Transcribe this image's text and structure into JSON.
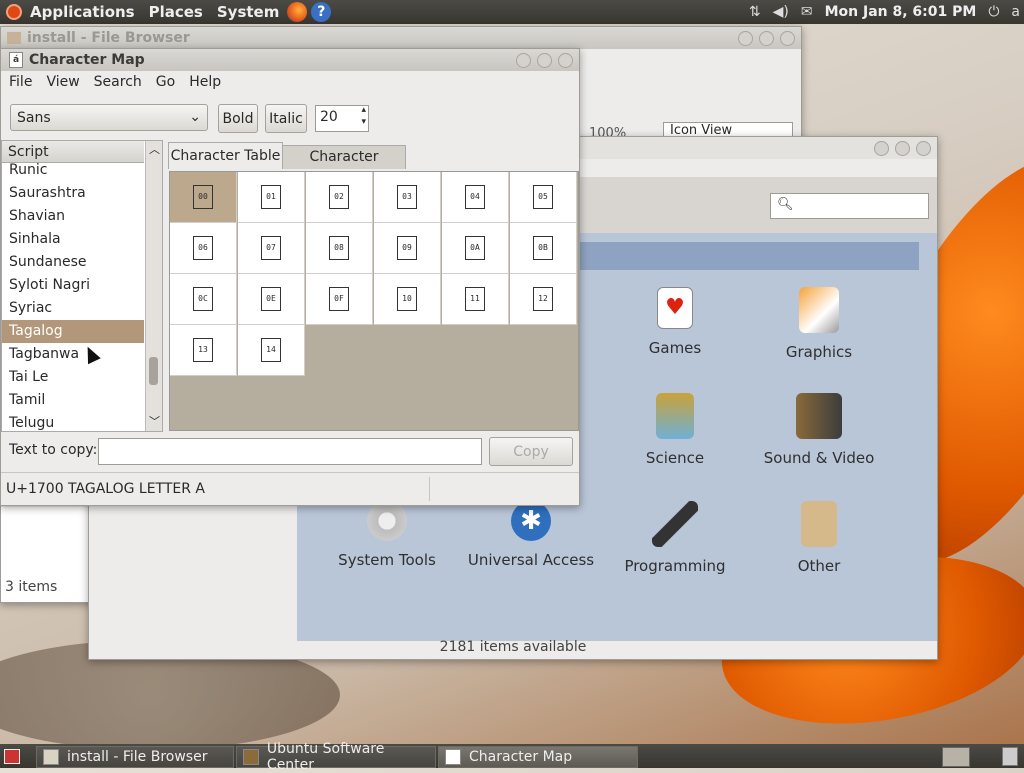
{
  "top_panel": {
    "menus": [
      "Applications",
      "Places",
      "System"
    ],
    "clock": "Mon Jan  8,  6:01 PM",
    "user": "a"
  },
  "file_browser": {
    "title": "install - File Browser",
    "zoom": "100%",
    "view_mode": "Icon View",
    "status": "3 items"
  },
  "software_center": {
    "title": "Ubuntu Software Center",
    "categories": [
      "Games",
      "Graphics",
      "Science",
      "Sound & Video",
      "System Tools",
      "Universal Access",
      "Programming",
      "Other"
    ],
    "status": "2181 items available"
  },
  "char_map": {
    "title": "Character Map",
    "menu": [
      "File",
      "View",
      "Search",
      "Go",
      "Help"
    ],
    "font": "Sans",
    "bold_label": "Bold",
    "italic_label": "Italic",
    "size": "20",
    "script_header": "Script",
    "scripts": [
      "Runic",
      "Saurashtra",
      "Shavian",
      "Sinhala",
      "Sundanese",
      "Syloti Nagri",
      "Syriac",
      "Tagalog",
      "Tagbanwa",
      "Tai Le",
      "Tamil",
      "Telugu"
    ],
    "selected_script": "Tagalog",
    "tabs": [
      "Character Table",
      "Character Details"
    ],
    "codes": [
      "00",
      "01",
      "02",
      "03",
      "04",
      "05",
      "06",
      "07",
      "08",
      "09",
      "0A",
      "0B",
      "0C",
      "0E",
      "0F",
      "10",
      "11",
      "12",
      "13",
      "14"
    ],
    "text_to_copy_label": "Text to copy:",
    "copy_label": "Copy",
    "status": "U+1700 TAGALOG LETTER A"
  },
  "taskbar": [
    "install - File Browser",
    "Ubuntu Software Center",
    "Character Map"
  ]
}
